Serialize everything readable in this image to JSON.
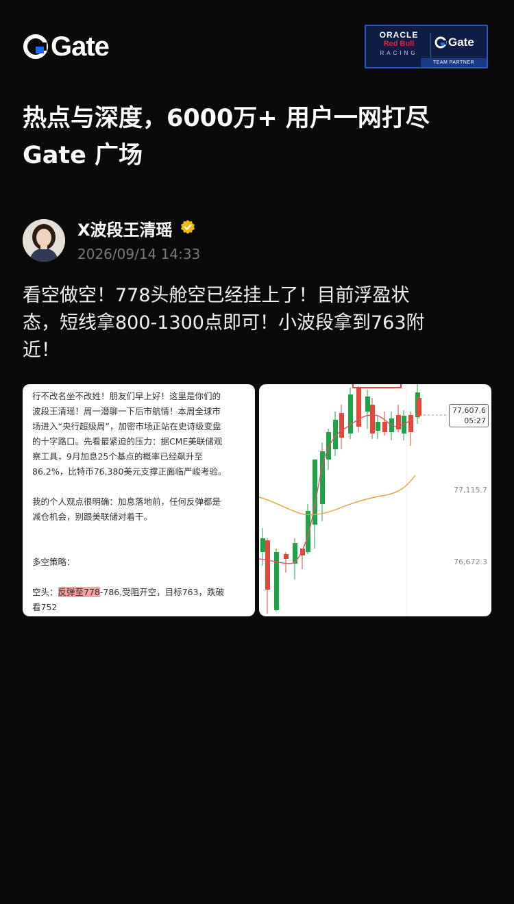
{
  "brand": {
    "name": "Gate",
    "accent": "#1a6bf5"
  },
  "partner_badge": {
    "oracle": "ORACLE",
    "redbull": "Red Bull",
    "racing": "RACING",
    "gate": "Gate",
    "team_partner": "TEAM PARTNER"
  },
  "headline": {
    "line1": "热点与深度，6000万+ 用户一网打尽",
    "line2": "Gate 广场"
  },
  "author": {
    "name": "X波段王清瑶",
    "timestamp": "2026/09/14 14:33",
    "verified_icon": "verified-badge-icon"
  },
  "post": {
    "line1": "看空做空！778头舱空已经挂上了！目前浮盈状",
    "line2": "态，短线拿800-1300点即可！小波段拿到763附",
    "line3": "近！"
  },
  "image_text": {
    "p1_l1": "行不改名坐不改姓！朋友们早上好！这里是你们的",
    "p1_l2": "波段王清瑶！周一潜聊一下后市航情！本周全球市",
    "p1_l3": "场进入“央行超级周”，加密市场正站在史诗级变盘",
    "p1_l4": "的十字路口。先看最紧迫的压力：据CME美联储观",
    "p1_l5": "察工具，9月加息25个基点的概率已经飙升至",
    "p1_l6": "86.2%，比特币76,380美元支撑正面临严峻考验。",
    "p2_l1": "我的个人观点很明确：加息落地前，任何反弹都是",
    "p2_l2": "减仓机会，别跟美联储对着干。",
    "p3_l1": "多空策略：",
    "p4_prefix": "空头：",
    "p4_highlight": "反弹至778",
    "p4_rest": "-786,受阻开空，目标763，跌破",
    "p4_l2": "看752"
  },
  "chart_data": {
    "type": "candlestick",
    "price_tag": {
      "price": "77,607.6",
      "countdown": "05:27"
    },
    "y_tick_labels": [
      "77,115.7",
      "76,672.3"
    ],
    "colors": {
      "up": "#1fa34a",
      "down": "#e2473b",
      "ma_fast": "#e0506a",
      "ma_slow": "#e8a23a"
    }
  }
}
